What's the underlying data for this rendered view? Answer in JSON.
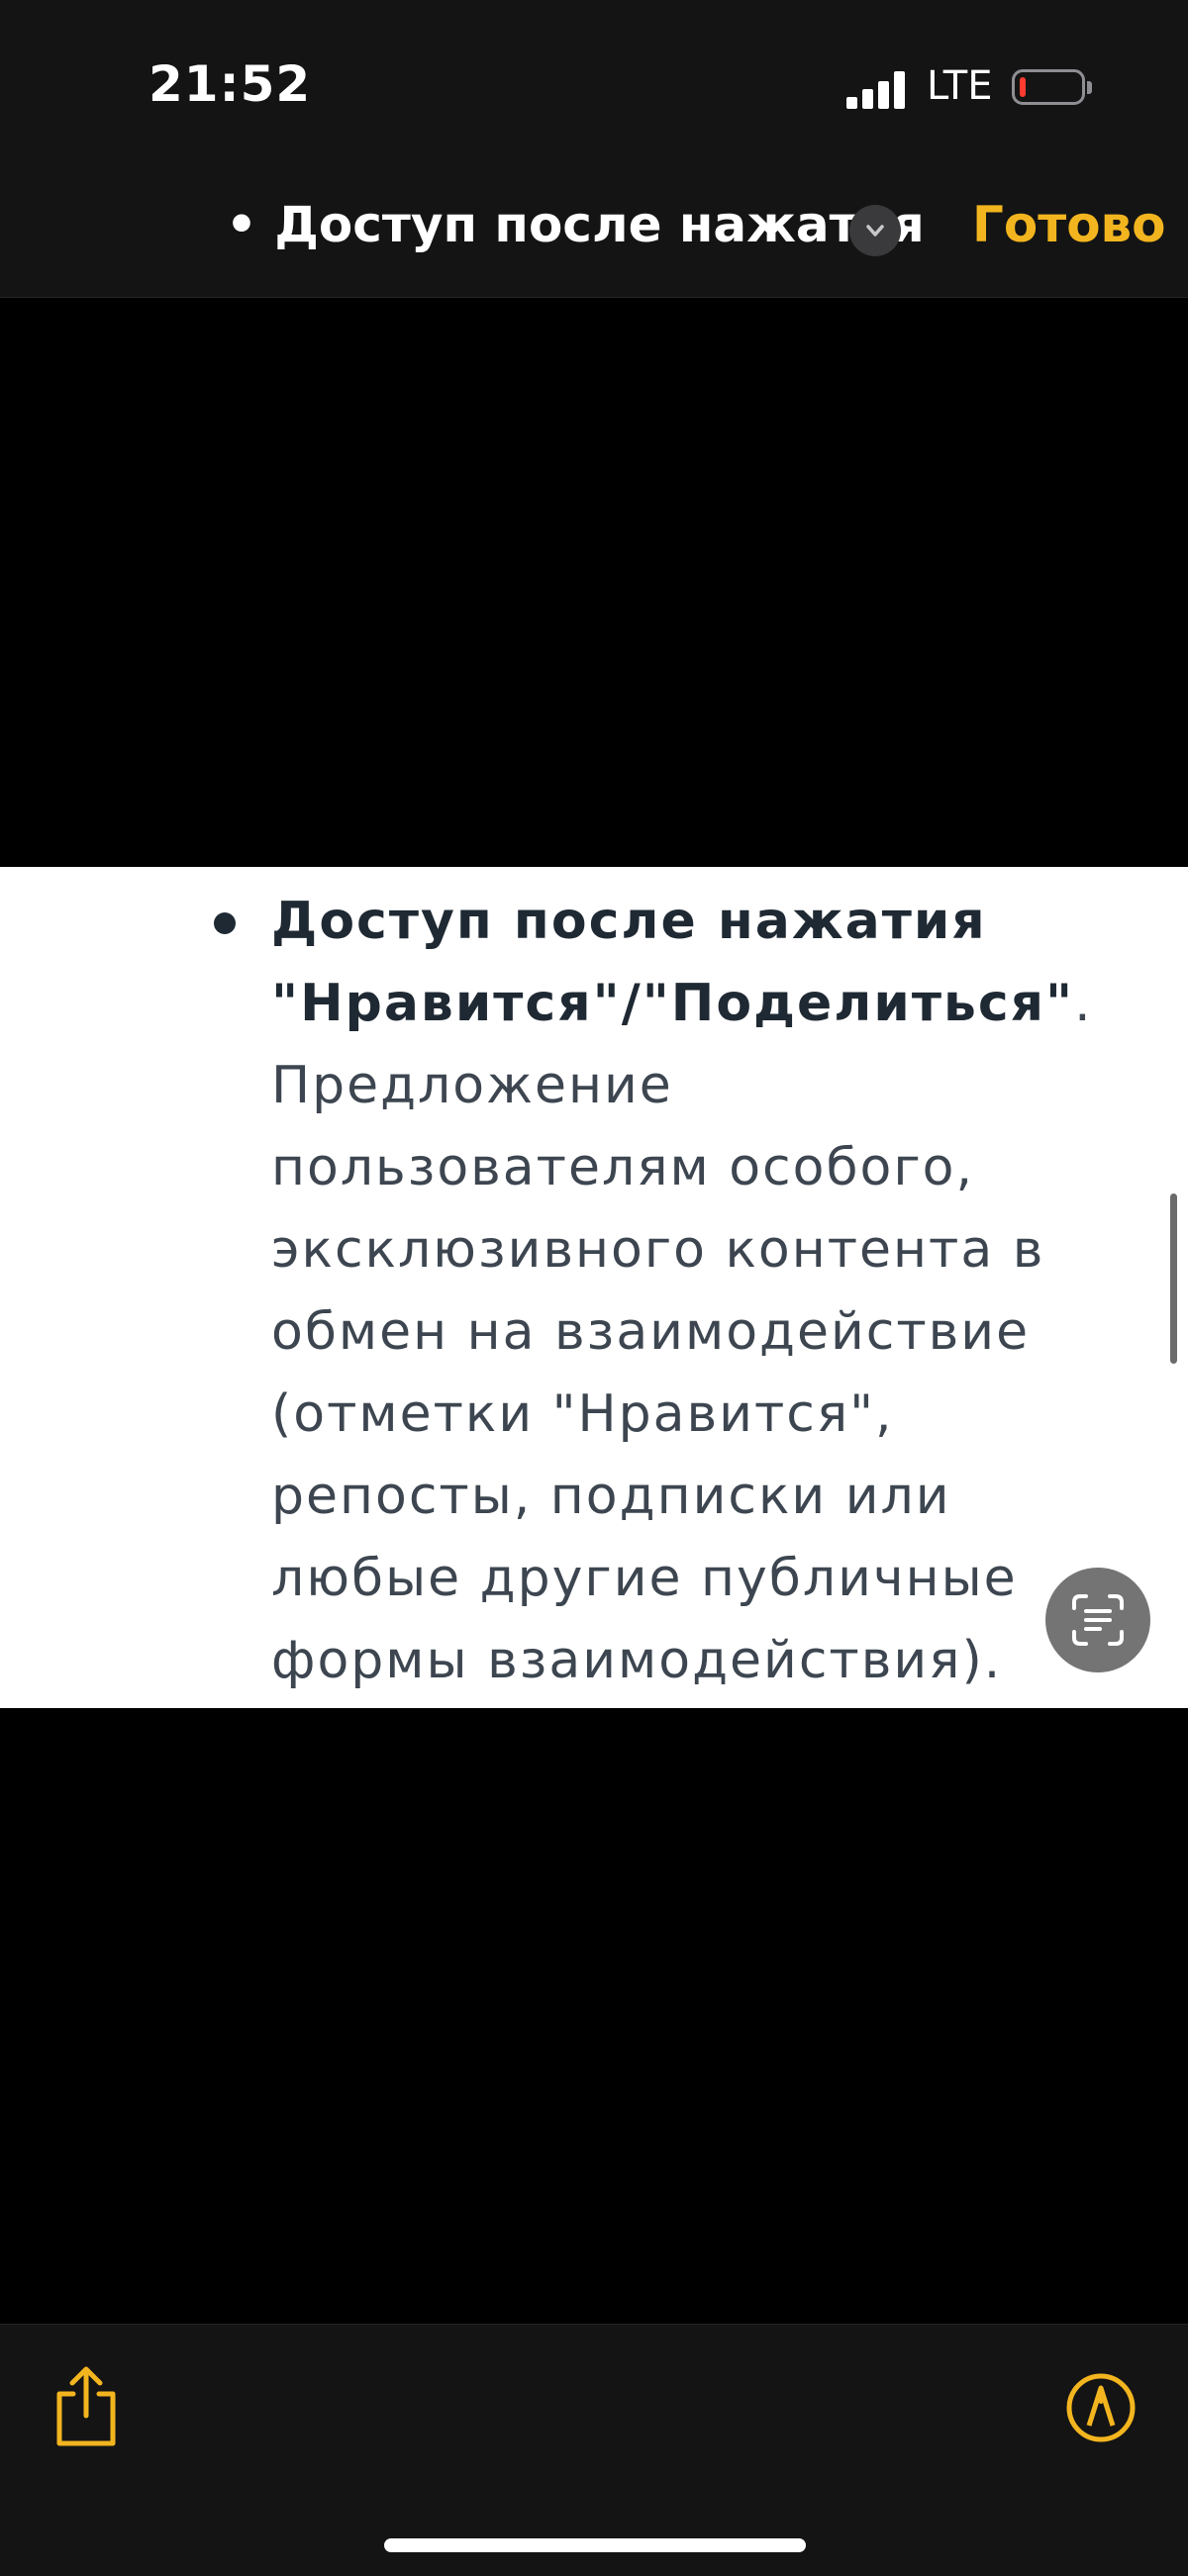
{
  "status_bar": {
    "time": "21:52",
    "network": "LTE",
    "battery_level": 0.08,
    "battery_color": "#ff3b30"
  },
  "nav_bar": {
    "title": "• Доступ после нажатия",
    "title_menu_icon": "chevron-down-icon",
    "done_label": "Готово",
    "accent_color": "#f3b51f"
  },
  "content": {
    "bullet": {
      "heading_line1": "Доступ после нажатия",
      "heading_line2": "\"Нравится\"/\"Поделиться\"",
      "heading_tail": ".",
      "body_lines": [
        "Предложение",
        "пользователям особого,",
        "эксклюзивного контента в",
        "обмен на взаимодействие",
        "(отметки \"Нравится\",",
        "репосты, подписки или",
        "любые другие публичные",
        "формы взаимодействия)."
      ]
    }
  },
  "overlay": {
    "live_text_icon": "live-text-icon"
  },
  "toolbar": {
    "share_icon": "share-icon",
    "markup_icon": "markup-icon"
  }
}
